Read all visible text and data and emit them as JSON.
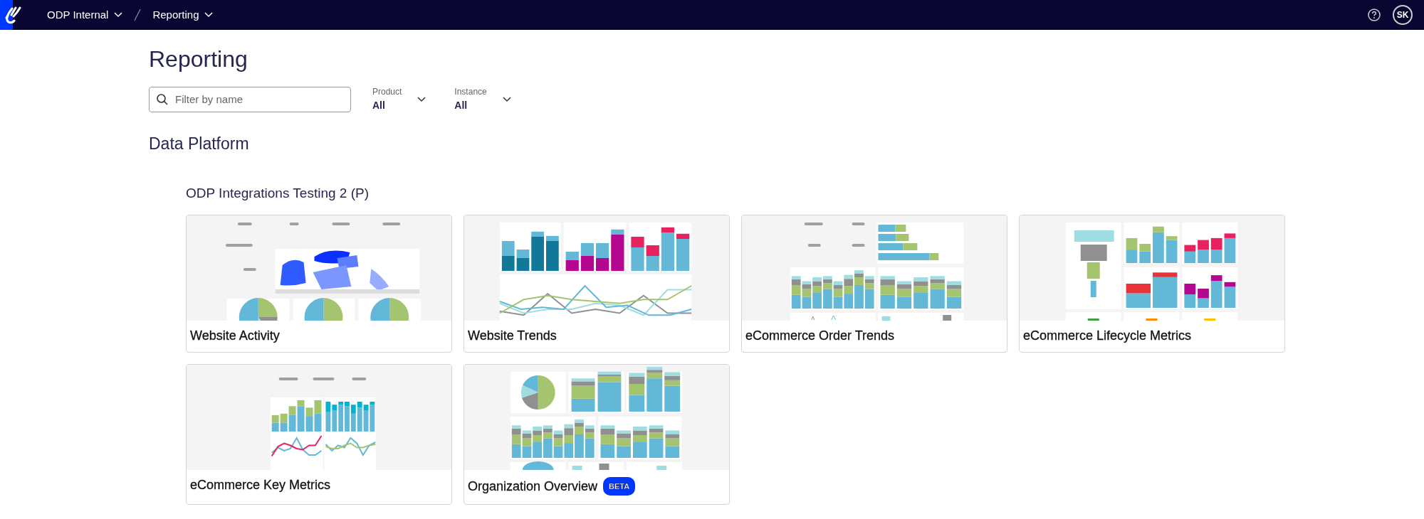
{
  "top_bar": {
    "breadcrumbs": [
      {
        "label": "ODP Internal"
      },
      {
        "label": "Reporting"
      }
    ],
    "avatar": "SK"
  },
  "page": {
    "title": "Reporting"
  },
  "filters": {
    "search": {
      "placeholder": "Filter by name"
    },
    "dropdowns": [
      {
        "label": "Product",
        "value": "All"
      },
      {
        "label": "Instance",
        "value": "All"
      }
    ]
  },
  "section": {
    "title": "Data Platform",
    "group": "ODP Integrations Testing 2 (P)"
  },
  "reports": [
    {
      "title": "Website Activity",
      "kind": "map"
    },
    {
      "title": "Website Trends",
      "kind": "trends"
    },
    {
      "title": "eCommerce Order Trends",
      "kind": "orders"
    },
    {
      "title": "eCommerce Lifecycle Metrics",
      "kind": "lifecycle"
    },
    {
      "title": "eCommerce Key Metrics",
      "kind": "key"
    },
    {
      "title": "Organization Overview",
      "kind": "overview",
      "badge": "BETA"
    }
  ]
}
